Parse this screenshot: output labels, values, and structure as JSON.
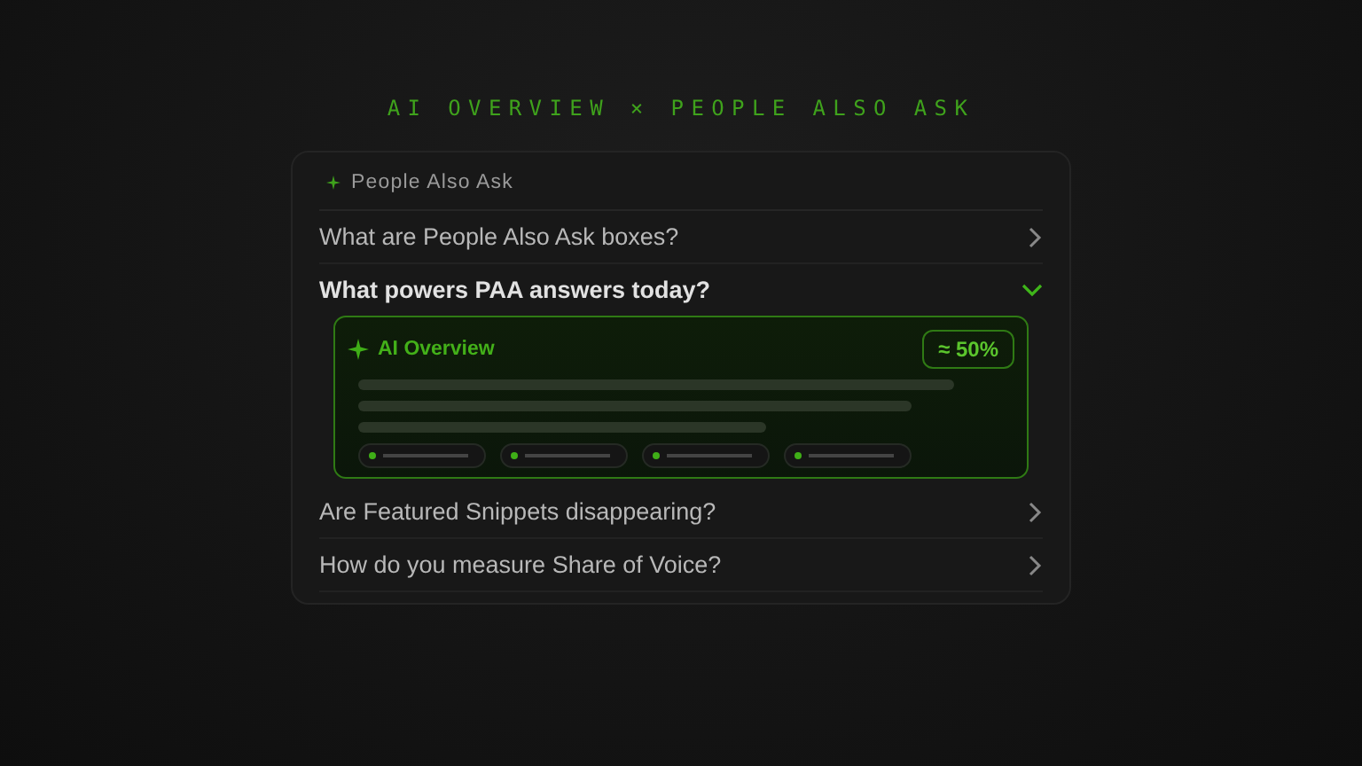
{
  "title": "AI OVERVIEW × PEOPLE ALSO ASK",
  "panel": {
    "heading": "People Also Ask"
  },
  "questions": [
    {
      "text": "What are People Also Ask boxes?",
      "expanded": false
    },
    {
      "text": "What powers PAA answers today?",
      "expanded": true,
      "overview": {
        "label": "AI Overview",
        "badge": "≈ 50%"
      }
    },
    {
      "text": "Are Featured Snippets disappearing?",
      "expanded": false
    },
    {
      "text": "How do you measure Share of Voice?",
      "expanded": false
    }
  ]
}
